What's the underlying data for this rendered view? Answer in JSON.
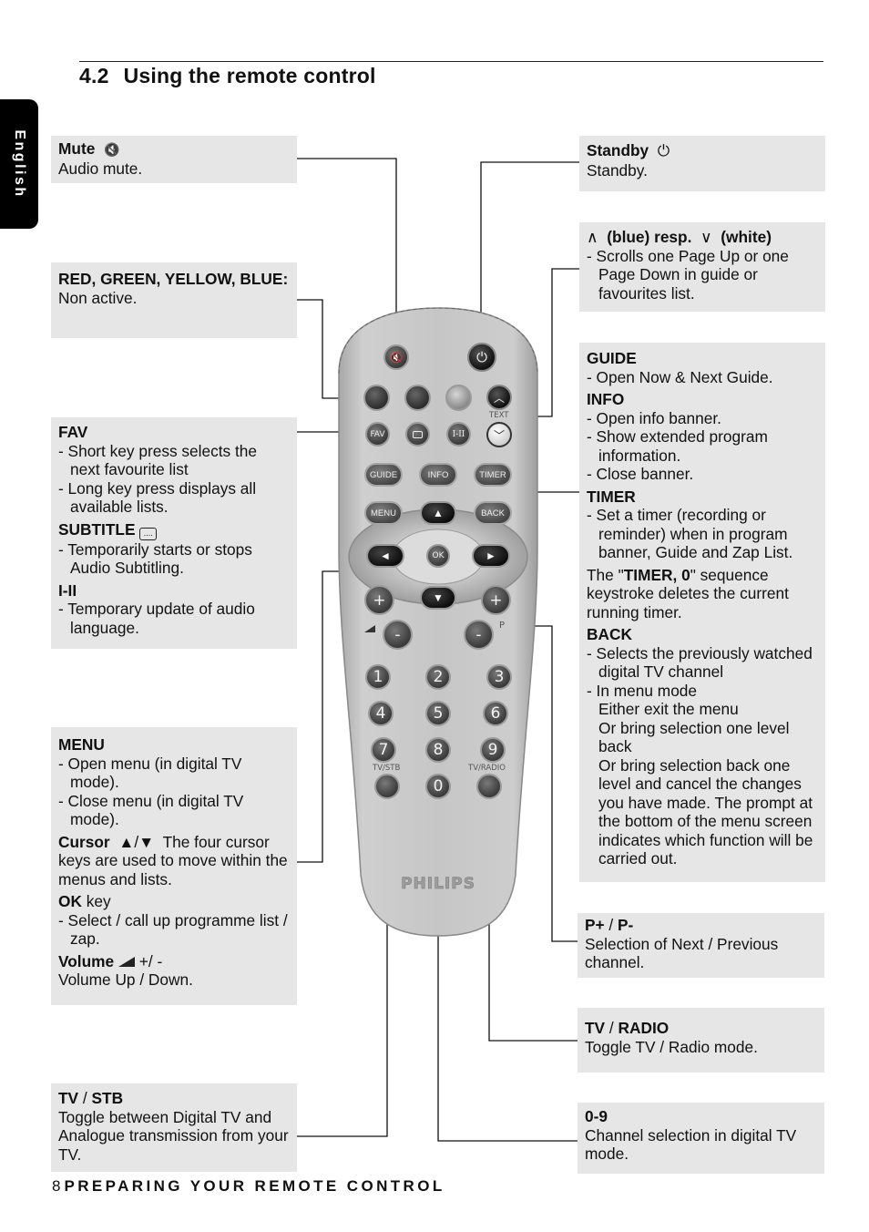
{
  "header": {
    "section_number": "4.2",
    "section_title": "Using the remote control"
  },
  "language_tab": "English",
  "footer": {
    "page_number": "8",
    "chapter_title": "PREPARING YOUR REMOTE CONTROL"
  },
  "remote": {
    "brand": "PHILIPS",
    "buttons": {
      "mute": "mute-icon",
      "standby": "power-icon",
      "fav": "FAV",
      "subtitle": "subtitle-icon",
      "i_ii": "I-II",
      "text_label": "TEXT",
      "guide": "GUIDE",
      "info": "INFO",
      "timer": "TIMER",
      "menu": "MENU",
      "back": "BACK",
      "ok": "OK",
      "up": "▲",
      "down": "▼",
      "left": "◄",
      "right": "►",
      "vol_plus": "+",
      "vol_minus": "-",
      "p_plus": "+",
      "p_minus": "-",
      "p_label": "P",
      "digits": [
        "1",
        "2",
        "3",
        "4",
        "5",
        "6",
        "7",
        "8",
        "9",
        "0"
      ],
      "tv_stb_label": "TV/STB",
      "tv_radio_label": "TV/RADIO"
    }
  },
  "callouts": {
    "mute": {
      "title": "Mute",
      "icon": "🔇",
      "text": "Audio mute."
    },
    "colors": {
      "title": "RED, GREEN, YELLOW, BLUE:",
      "text": "Non active."
    },
    "fav": {
      "title": "FAV",
      "items": [
        "- Short key press selects the next favourite list",
        "- Long key press displays all available lists."
      ],
      "subtitle_title": "SUBTITLE",
      "subtitle_items": [
        "- Temporarily starts or stops Audio Subtitling."
      ],
      "i_ii_title": "I-II",
      "i_ii_items": [
        "- Temporary update of audio language."
      ]
    },
    "menu": {
      "title": "MENU",
      "items": [
        "- Open menu (in digital TV mode).",
        "- Close menu (in digital TV mode)."
      ],
      "cursor_title": "Cursor",
      "cursor_symbols": "▲/▼",
      "cursor_text": "The four cursor keys are used to move within the menus and lists.",
      "ok_title": "OK",
      "ok_suffix": "key",
      "ok_items": [
        "- Select / call up programme list / zap."
      ],
      "volume_title": "Volume",
      "volume_suffix": "+/ -",
      "volume_text": "Volume Up / Down."
    },
    "tv_stb": {
      "title_a": "TV",
      "sep": " / ",
      "title_b": "STB",
      "text": "Toggle between Digital TV and Analogue transmission from your TV."
    },
    "standby": {
      "title": "Standby",
      "text": "Standby."
    },
    "page": {
      "up_sym": "∧",
      "title": "(blue) resp.",
      "down_sym": "∨",
      "title2": "(white)",
      "items": [
        "- Scrolls one Page Up or one Page Down in guide or favourites list."
      ]
    },
    "guide": {
      "title": "GUIDE",
      "items": [
        "- Open Now & Next Guide."
      ],
      "info_title": "INFO",
      "info_items": [
        "- Open info banner.",
        "- Show extended program information.",
        "- Close banner."
      ],
      "timer_title": "TIMER",
      "timer_items": [
        "- Set a timer (recording or reminder) when in program banner, Guide and Zap List."
      ],
      "timer_note_pre": "The \"",
      "timer_note_bold": "TIMER, 0",
      "timer_note_post": "\" sequence keystroke deletes the current running timer.",
      "back_title": "BACK",
      "back_items": [
        "- Selects the previously watched digital TV channel",
        "- In menu mode"
      ],
      "back_cont": [
        "Either exit  the menu",
        "Or bring selection one level back",
        "Or bring selection back one level and cancel the changes you have made. The prompt at the bottom of the menu screen indicates which function will be carried out."
      ]
    },
    "p": {
      "title_a": "P+",
      "sep": " / ",
      "title_b": "P-",
      "text": "Selection of Next / Previous channel."
    },
    "tv_radio": {
      "title_a": "TV",
      "sep": " / ",
      "title_b": "RADIO",
      "text": "Toggle TV / Radio mode."
    },
    "digits": {
      "title": "0-9",
      "text": "Channel selection in digital TV mode."
    }
  }
}
